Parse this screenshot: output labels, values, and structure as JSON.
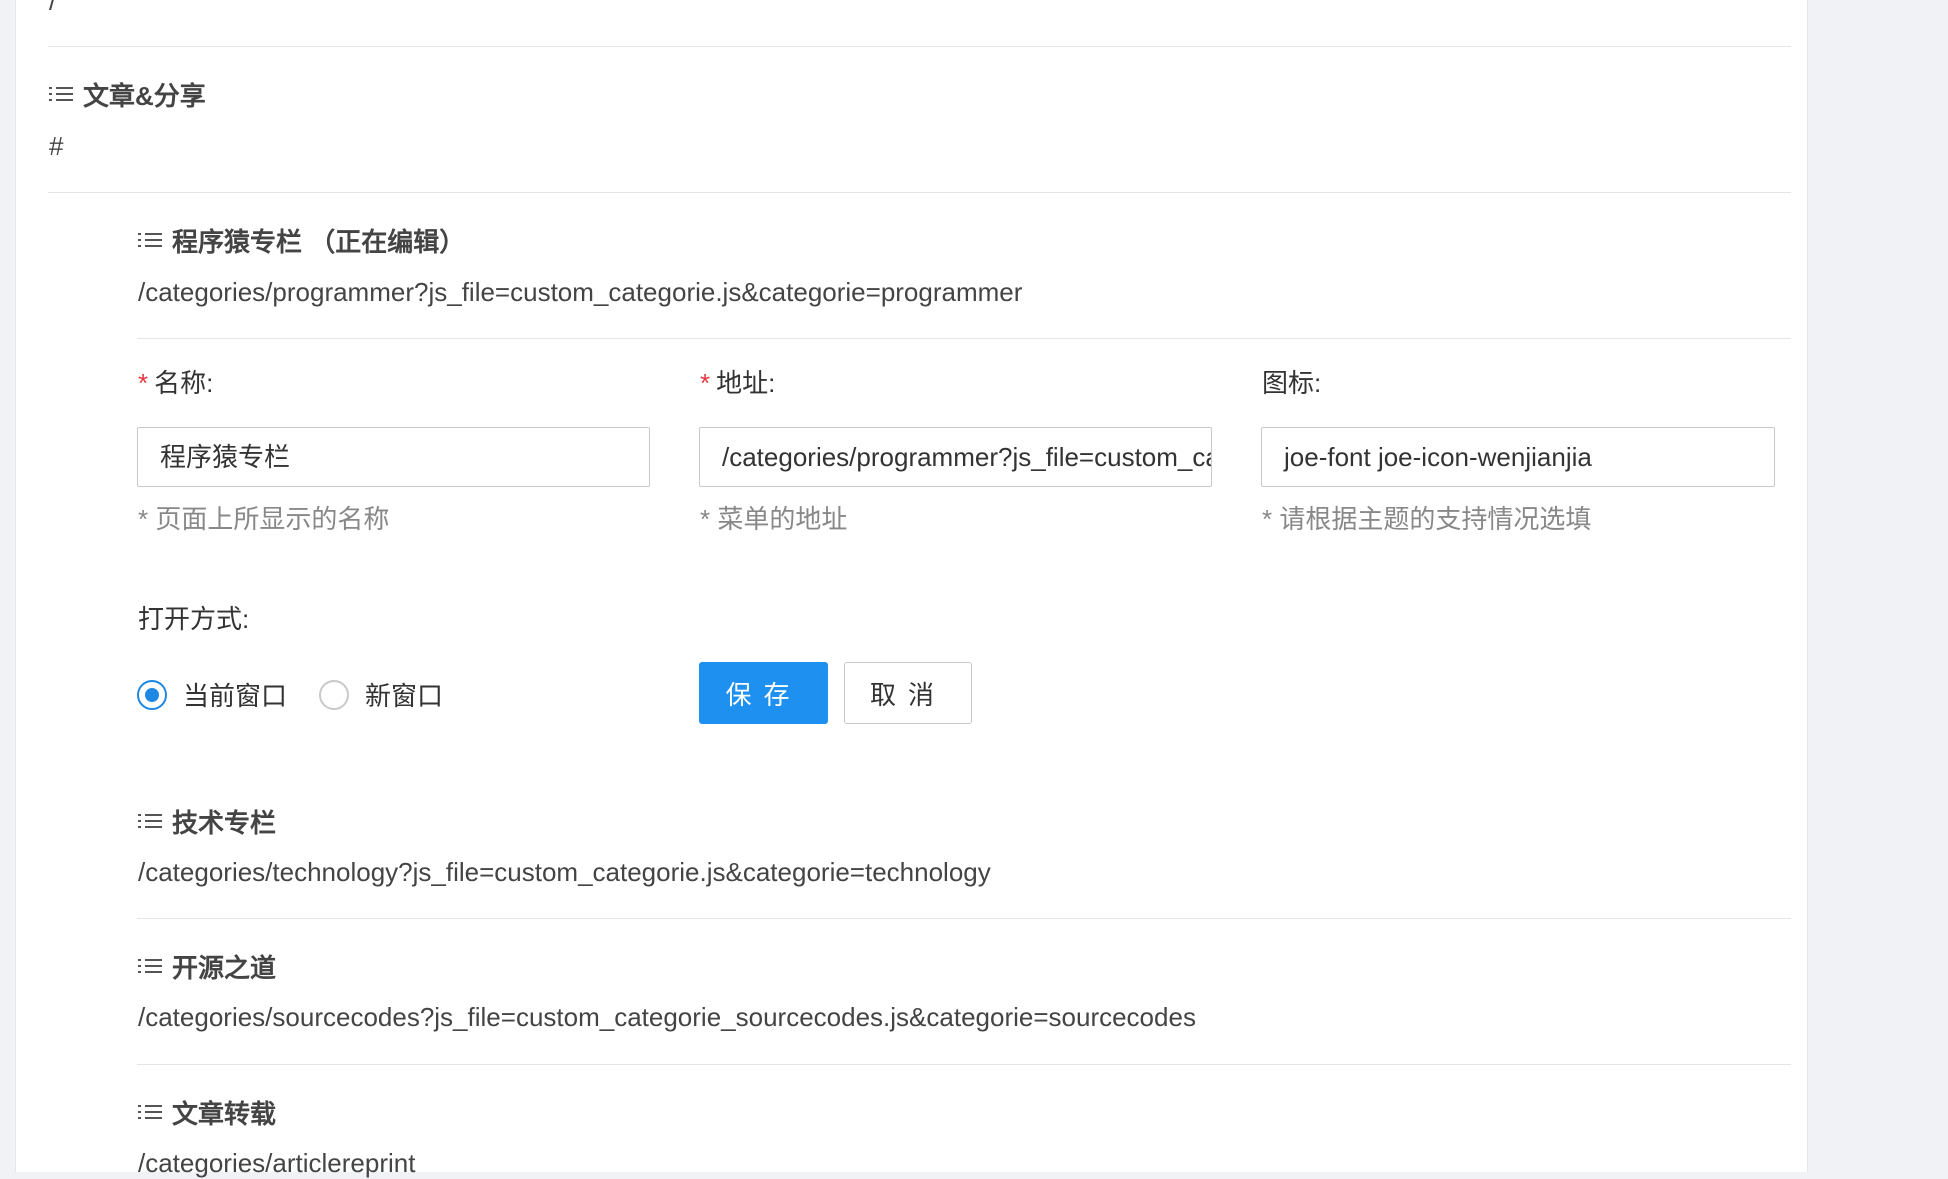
{
  "menus": {
    "home": {
      "url": "/"
    },
    "articles": {
      "title": "文章&分享",
      "url": "#"
    },
    "programmer": {
      "title": "程序猿专栏 （正在编辑）",
      "url": "/categories/programmer?js_file=custom_categorie.js&categorie=programmer"
    },
    "technology": {
      "title": "技术专栏",
      "url": "/categories/technology?js_file=custom_categorie.js&categorie=technology"
    },
    "sourcecodes": {
      "title": "开源之道",
      "url": "/categories/sourcecodes?js_file=custom_categorie_sourcecodes.js&categorie=sourcecodes"
    },
    "reprint": {
      "title": "文章转载",
      "url": "/categories/articlereprint"
    }
  },
  "form": {
    "required_mark": "*",
    "name": {
      "label": "名称:",
      "value": "程序猿专栏",
      "hint": "* 页面上所显示的名称"
    },
    "address": {
      "label": "地址:",
      "value": "/categories/programmer?js_file=custom_categorie.js&categorie=programmer",
      "hint": "* 菜单的地址"
    },
    "icon": {
      "label": "图标:",
      "value": "joe-font joe-icon-wenjianjia",
      "hint": "* 请根据主题的支持情况选填"
    },
    "open_mode": {
      "label": "打开方式:",
      "options": [
        {
          "label": "当前窗口",
          "checked": true
        },
        {
          "label": "新窗口",
          "checked": false
        }
      ]
    },
    "save_label": "保存",
    "cancel_label": "取消"
  },
  "colors": {
    "primary": "#1e90f0",
    "required": "#e4393c",
    "hint": "#888888",
    "background": "#f0f2f5"
  },
  "icons": {
    "menu_item": "list-icon",
    "radio": "radio-dot"
  }
}
